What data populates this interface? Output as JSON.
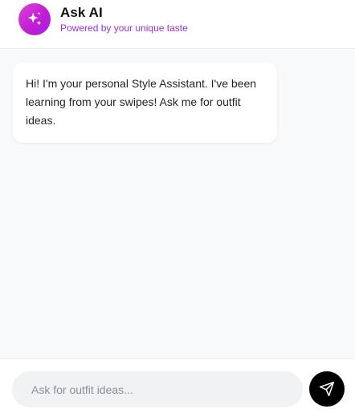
{
  "header": {
    "title": "Ask AI",
    "subtitle": "Powered by your unique taste",
    "logo_icon": "sparkles-icon"
  },
  "messages": [
    {
      "role": "assistant",
      "text": "Hi! I'm your personal Style Assistant. I've been learning from your swipes! Ask me for outfit ideas."
    }
  ],
  "composer": {
    "placeholder": "Ask for outfit ideas...",
    "value": "",
    "send_icon": "send-icon"
  },
  "colors": {
    "accent": "#c21fd4",
    "subtitle": "#9b30d9",
    "send_button": "#000000"
  }
}
